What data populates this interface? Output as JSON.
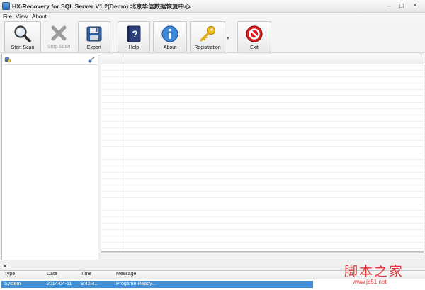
{
  "window": {
    "title": "HX-Recovery for SQL Server V1.2(Demo) 北京华信数据恢复中心",
    "controls": {
      "minimize": "–",
      "maximize": "□",
      "close": "×"
    }
  },
  "menu": {
    "items": [
      "File",
      "View",
      "About"
    ]
  },
  "toolbar": {
    "start_scan": "Start Scan",
    "stop_scan": "Stop Scan",
    "export": "Export",
    "help": "Help",
    "about": "About",
    "registration": "Registration",
    "dropdown": "▾",
    "exit": "Exit",
    "icons": {
      "start_scan": "magnifier-icon",
      "stop_scan": "x-mark-icon",
      "export": "floppy-disk-icon",
      "help": "help-book-icon",
      "about": "info-icon",
      "registration": "key-icon",
      "exit": "no-entry-icon"
    }
  },
  "log": {
    "close": "×",
    "columns": [
      "Type",
      "Date",
      "Time",
      "Message"
    ],
    "rows": [
      {
        "type": "System",
        "date": "2014-04-11",
        "time": "9:42:41",
        "message": "Progame Ready..."
      }
    ]
  },
  "watermark": {
    "text_cn": "脚本之家",
    "url": "www.jb51.net"
  },
  "colors": {
    "selection": "#3f8fd9",
    "watermark": "#e03a3a",
    "stop_disabled": "#9a9a9a"
  }
}
